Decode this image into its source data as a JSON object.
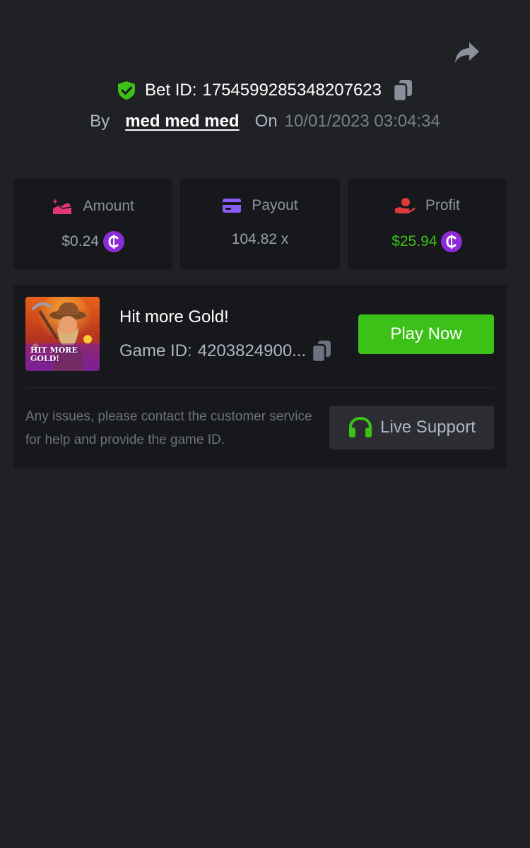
{
  "header": {
    "bet_id_prefix": "Bet ID:",
    "bet_id": "1754599285348207623",
    "by_label": "By",
    "username": "med med med",
    "on_label": "On",
    "datetime": "10/01/2023 03:04:34"
  },
  "stats": {
    "amount": {
      "label": "Amount",
      "value": "$0.24",
      "icon": "coins-hand-icon"
    },
    "payout": {
      "label": "Payout",
      "value": "104.82 x",
      "icon": "card-icon"
    },
    "profit": {
      "label": "Profit",
      "value": "$25.94",
      "icon": "hand-coin-icon"
    }
  },
  "game": {
    "title": "Hit more Gold!",
    "id_prefix": "Game ID:",
    "id_truncated": "4203824900...",
    "thumb_text_line1": "HIT MORE",
    "thumb_text_line2": "GOLD!",
    "play_label": "Play Now",
    "help_text": "Any issues, please contact the customer service for help and provide the game ID.",
    "support_label": "Live Support"
  },
  "colors": {
    "background": "#202125",
    "card": "#17181b",
    "accent_green": "#3bc117",
    "coin_purple": "#8e2bd9",
    "amount_pink": "#e5357a",
    "payout_purple": "#8b5cf6",
    "profit_red": "#e03a3a"
  }
}
